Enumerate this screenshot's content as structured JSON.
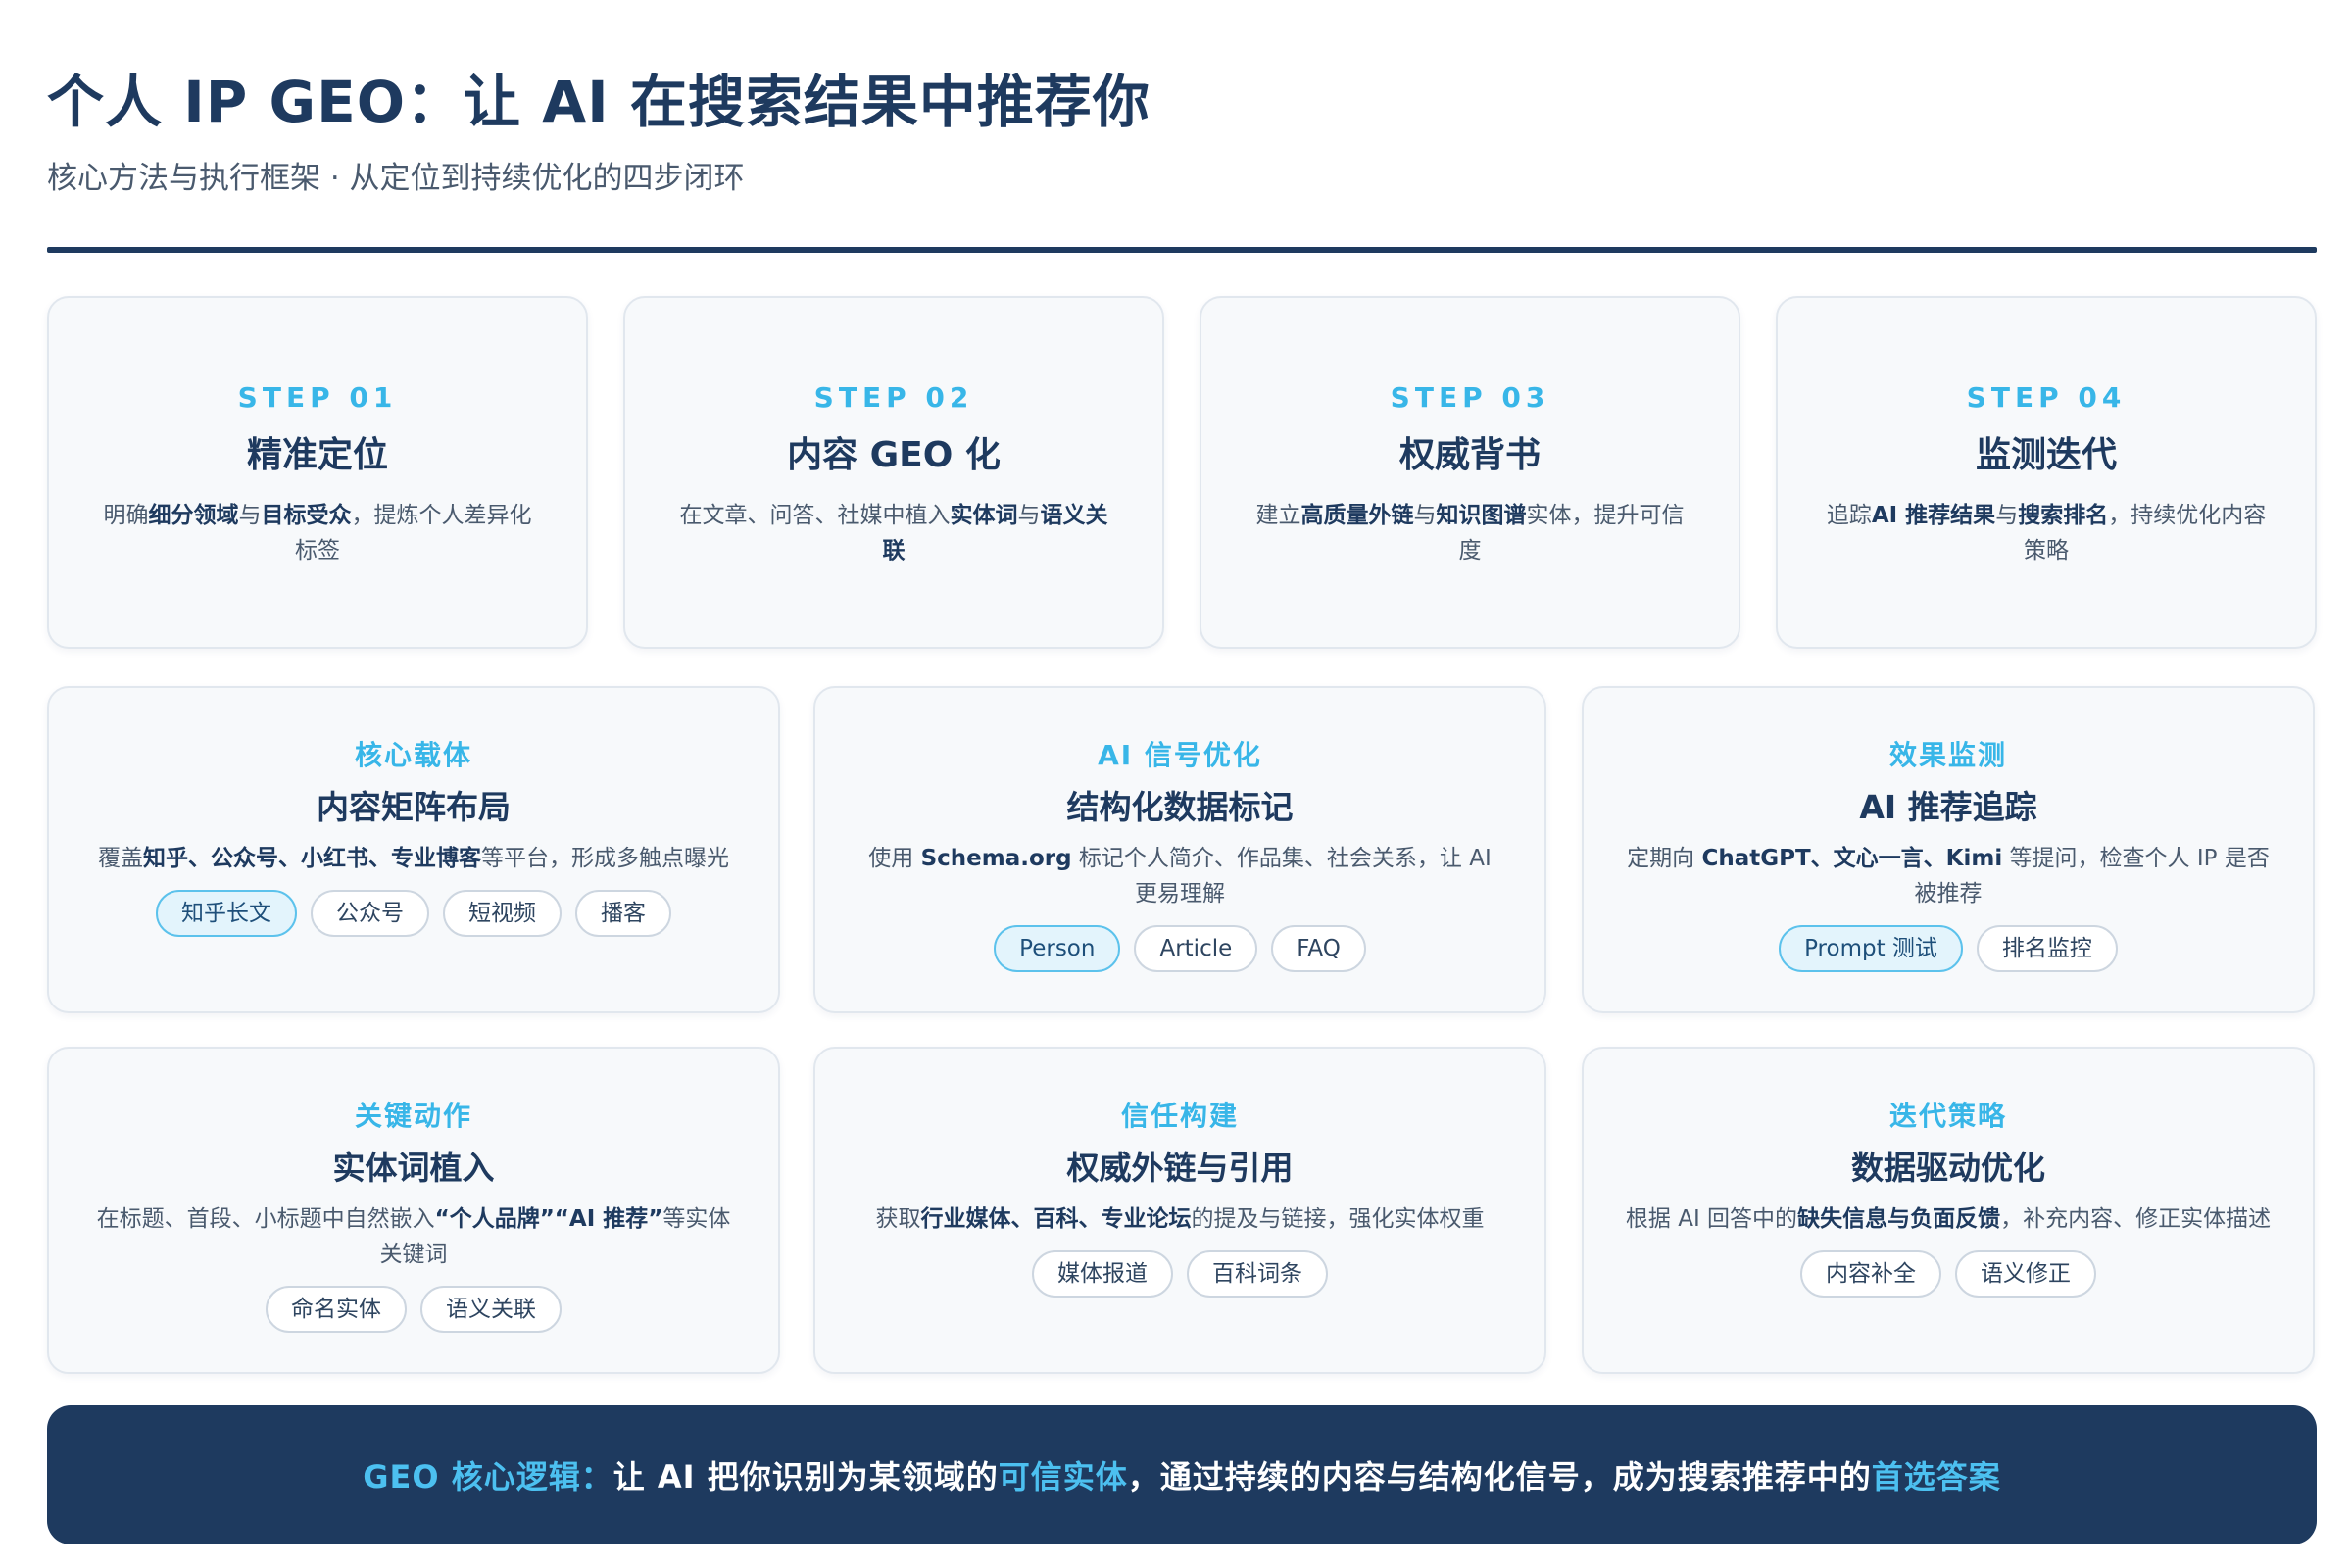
{
  "header": {
    "title": "个人 IP GEO：让 AI 在搜索结果中推荐你",
    "subtitle": "核心方法与执行框架 · 从定位到持续优化的四步闭环"
  },
  "steps": [
    {
      "label": "STEP 01",
      "title": "精准定位",
      "desc": [
        "明确",
        "细分领域",
        "与",
        "目标受众",
        "，提炼个人差异化标签"
      ]
    },
    {
      "label": "STEP 02",
      "title": "内容 GEO 化",
      "desc": [
        "在文章、问答、社媒中植入",
        "实体词",
        "与",
        "语义关联",
        ""
      ]
    },
    {
      "label": "STEP 03",
      "title": "权威背书",
      "desc": [
        "建立",
        "高质量外链",
        "与",
        "知识图谱",
        "实体，提升可信度"
      ]
    },
    {
      "label": "STEP 04",
      "title": "监测迭代",
      "desc": [
        "追踪",
        "AI 推荐结果",
        "与",
        "搜索排名",
        "，持续优化内容策略"
      ]
    }
  ],
  "details": [
    {
      "label": "核心载体",
      "title": "内容矩阵布局",
      "desc": [
        "覆盖",
        "知乎、公众号、小红书、专业博客",
        "等平台，形成多触点曝光"
      ],
      "tags": [
        "知乎长文",
        "公众号",
        "短视频",
        "播客"
      ]
    },
    {
      "label": "AI 信号优化",
      "title": "结构化数据标记",
      "desc": [
        "使用 ",
        "Schema.org",
        " 标记个人简介、作品集、社会关系，让 AI 更易理解"
      ],
      "tags": [
        "Person",
        "Article",
        "FAQ"
      ]
    },
    {
      "label": "效果监测",
      "title": "AI 推荐追踪",
      "desc": [
        "定期向 ",
        "ChatGPT、文心一言、Kimi",
        " 等提问，检查个人 IP 是否被推荐"
      ],
      "tags": [
        "Prompt 测试",
        "排名监控"
      ]
    },
    {
      "label": "关键动作",
      "title": "实体词植入",
      "desc": [
        "在标题、首段、小标题中自然嵌入",
        "“个人品牌”“AI 推荐”",
        "等实体关键词"
      ],
      "tags": [
        "命名实体",
        "语义关联"
      ]
    },
    {
      "label": "信任构建",
      "title": "权威外链与引用",
      "desc": [
        "获取",
        "行业媒体、百科、专业论坛",
        "的提及与链接，强化实体权重"
      ],
      "tags": [
        "媒体报道",
        "百科词条"
      ]
    },
    {
      "label": "迭代策略",
      "title": "数据驱动优化",
      "desc": [
        "根据 AI 回答中的",
        "缺失信息与负面反馈",
        "，补充内容、修正实体描述"
      ],
      "tags": [
        "内容补全",
        "语义修正"
      ]
    }
  ],
  "banner": {
    "lead": "GEO 核心逻辑：",
    "part1": "让 AI 把你识别为某领域的",
    "hl1": "可信实体",
    "part2": "，通过持续的内容与结构化信号，成为搜索推荐中的",
    "hl2": "首选答案"
  },
  "colors": {
    "primary": "#1e3a5f",
    "accent": "#38b6e8",
    "card_bg": "#f7f9fb"
  }
}
